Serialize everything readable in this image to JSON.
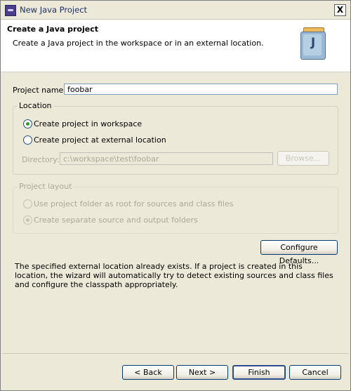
{
  "window": {
    "title": "New Java Project",
    "close_label": "X"
  },
  "header": {
    "title": "Create a Java project",
    "description": "Create a Java project in the workspace or in an external location.",
    "icon_letter": "J",
    "icon": "java-project-icon"
  },
  "project_name": {
    "label": "Project name:",
    "value": "foobar"
  },
  "location": {
    "group_label": "Location",
    "options": [
      {
        "label": "Create project in workspace",
        "checked": true
      },
      {
        "label": "Create project at external location",
        "checked": false
      }
    ],
    "directory_label": "Directory:",
    "directory_value": "c:\\workspace\\test\\foobar",
    "browse_label": "Browse..."
  },
  "project_layout": {
    "group_label": "Project layout",
    "options": [
      {
        "label": "Use project folder as root for sources and class files",
        "checked": false
      },
      {
        "label": "Create separate source and output folders",
        "checked": true
      }
    ]
  },
  "configure_defaults_label": "Configure Defaults...",
  "message": "The specified external location already exists. If a project is created in this location, the wizard will automatically try to detect existing sources and class files and configure the classpath appropriately.",
  "buttons": {
    "back": "< Back",
    "next": "Next >",
    "finish": "Finish",
    "cancel": "Cancel"
  },
  "colors": {
    "title_text": "#1d2f6a",
    "dialog_bg": "#ece9d8",
    "radio_checked": "#2f9a2f",
    "disabled_text": "#aca899"
  }
}
